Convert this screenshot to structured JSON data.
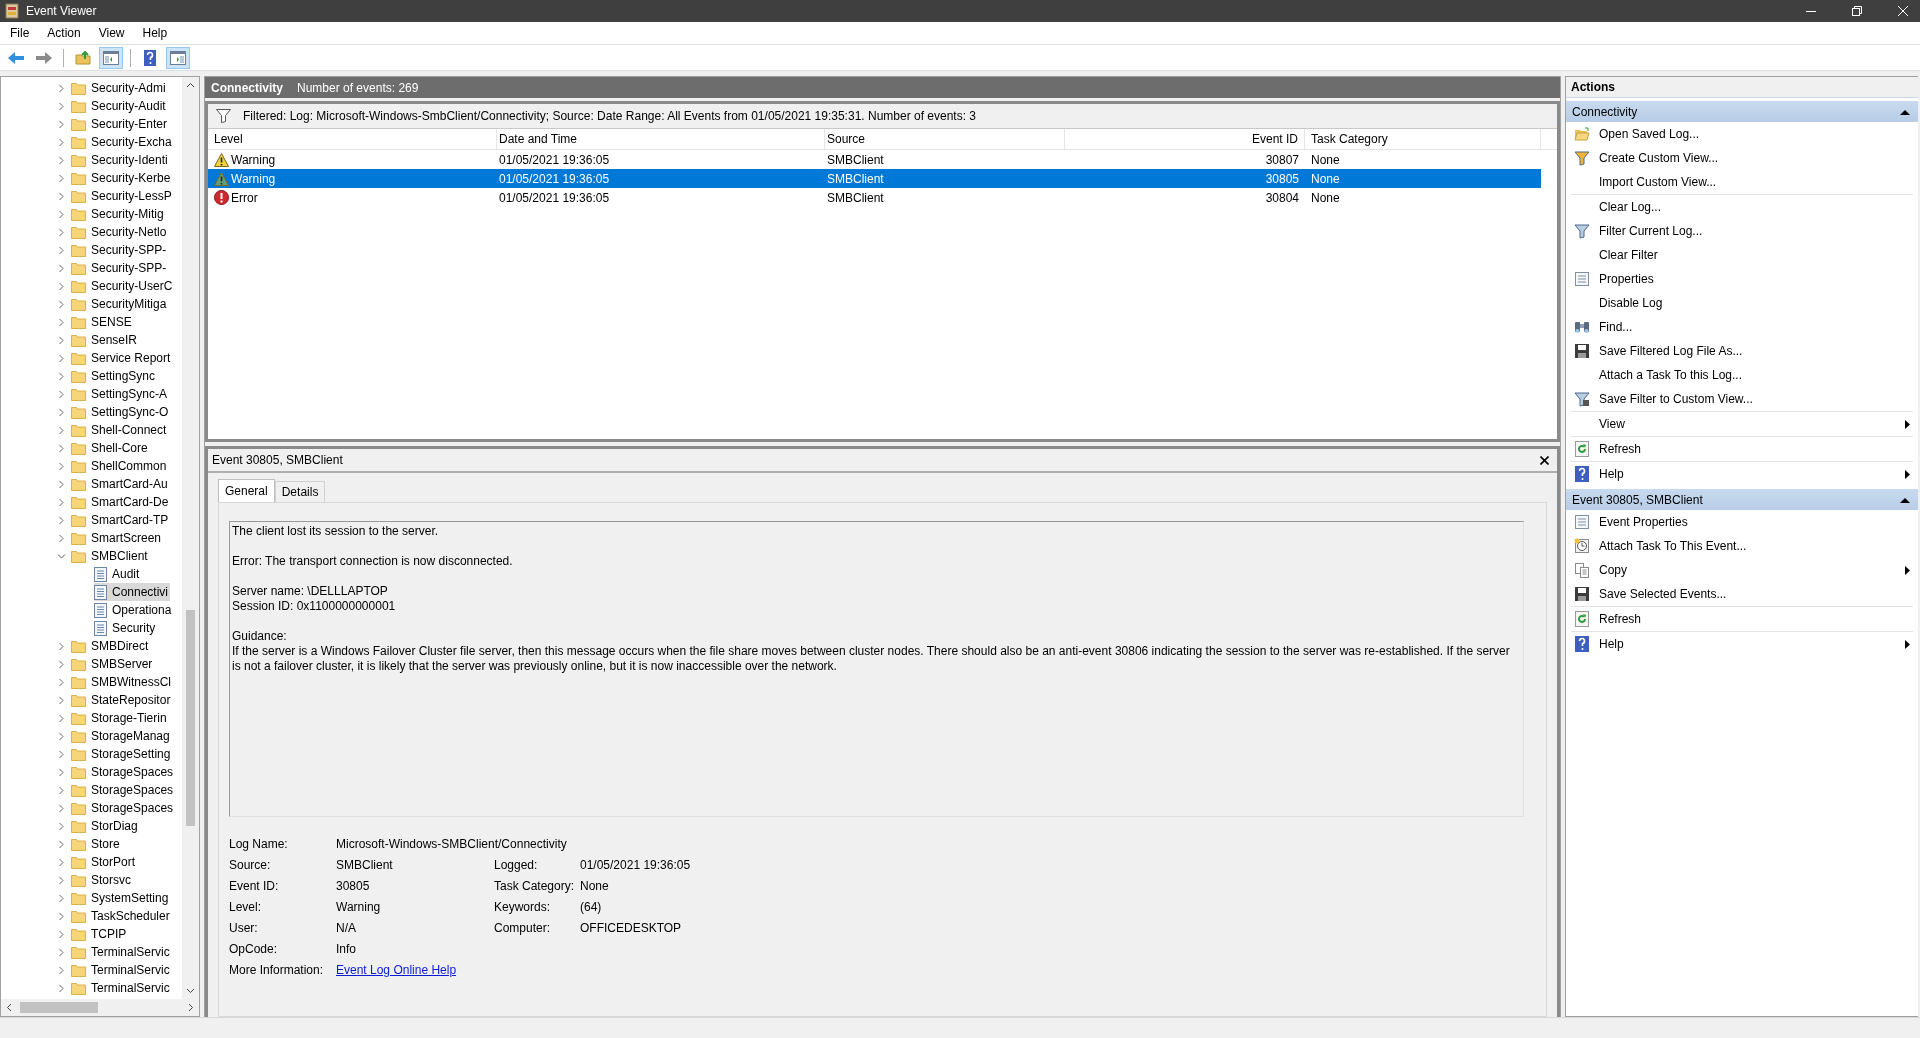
{
  "window": {
    "title": "Event Viewer"
  },
  "menu": [
    "File",
    "Action",
    "View",
    "Help"
  ],
  "toolbar": [
    {
      "kind": "back",
      "pressed": false
    },
    {
      "kind": "forward",
      "pressed": false
    },
    {
      "kind": "folder-up",
      "pressed": false
    },
    {
      "kind": "tree-pane",
      "pressed": true
    },
    {
      "kind": "help",
      "pressed": false
    },
    {
      "kind": "action-pane",
      "pressed": true
    }
  ],
  "tree": [
    {
      "label": "Security-Admi",
      "expanded": false,
      "selected": false
    },
    {
      "label": "Security-Audit",
      "expanded": false,
      "selected": false
    },
    {
      "label": "Security-Enter",
      "expanded": false,
      "selected": false
    },
    {
      "label": "Security-Excha",
      "expanded": false,
      "selected": false
    },
    {
      "label": "Security-Identi",
      "expanded": false,
      "selected": false
    },
    {
      "label": "Security-Kerbe",
      "expanded": false,
      "selected": false
    },
    {
      "label": "Security-LessP",
      "expanded": false,
      "selected": false
    },
    {
      "label": "Security-Mitig",
      "expanded": false,
      "selected": false
    },
    {
      "label": "Security-Netlo",
      "expanded": false,
      "selected": false
    },
    {
      "label": "Security-SPP-",
      "expanded": false,
      "selected": false
    },
    {
      "label": "Security-SPP-",
      "expanded": false,
      "selected": false
    },
    {
      "label": "Security-UserC",
      "expanded": false,
      "selected": false
    },
    {
      "label": "SecurityMitiga",
      "expanded": false,
      "selected": false
    },
    {
      "label": "SENSE",
      "expanded": false,
      "selected": false
    },
    {
      "label": "SenseIR",
      "expanded": false,
      "selected": false
    },
    {
      "label": "Service Report",
      "expanded": false,
      "selected": false
    },
    {
      "label": "SettingSync",
      "expanded": false,
      "selected": false
    },
    {
      "label": "SettingSync-A",
      "expanded": false,
      "selected": false
    },
    {
      "label": "SettingSync-O",
      "expanded": false,
      "selected": false
    },
    {
      "label": "Shell-Connect",
      "expanded": false,
      "selected": false
    },
    {
      "label": "Shell-Core",
      "expanded": false,
      "selected": false
    },
    {
      "label": "ShellCommon",
      "expanded": false,
      "selected": false
    },
    {
      "label": "SmartCard-Au",
      "expanded": false,
      "selected": false
    },
    {
      "label": "SmartCard-De",
      "expanded": false,
      "selected": false
    },
    {
      "label": "SmartCard-TP",
      "expanded": false,
      "selected": false
    },
    {
      "label": "SmartScreen",
      "expanded": false,
      "selected": false
    },
    {
      "label": "SMBClient",
      "expanded": true,
      "selected": false,
      "children": [
        {
          "label": "Audit",
          "selected": false
        },
        {
          "label": "Connectivi",
          "selected": true
        },
        {
          "label": "Operationa",
          "selected": false
        },
        {
          "label": "Security",
          "selected": false
        }
      ]
    },
    {
      "label": "SMBDirect",
      "expanded": false,
      "selected": false
    },
    {
      "label": "SMBServer",
      "expanded": false,
      "selected": false
    },
    {
      "label": "SMBWitnessCl",
      "expanded": false,
      "selected": false
    },
    {
      "label": "StateRepositor",
      "expanded": false,
      "selected": false
    },
    {
      "label": "Storage-Tierin",
      "expanded": false,
      "selected": false
    },
    {
      "label": "StorageManag",
      "expanded": false,
      "selected": false
    },
    {
      "label": "StorageSetting",
      "expanded": false,
      "selected": false
    },
    {
      "label": "StorageSpaces",
      "expanded": false,
      "selected": false
    },
    {
      "label": "StorageSpaces",
      "expanded": false,
      "selected": false
    },
    {
      "label": "StorageSpaces",
      "expanded": false,
      "selected": false
    },
    {
      "label": "StorDiag",
      "expanded": false,
      "selected": false
    },
    {
      "label": "Store",
      "expanded": false,
      "selected": false
    },
    {
      "label": "StorPort",
      "expanded": false,
      "selected": false
    },
    {
      "label": "Storsvc",
      "expanded": false,
      "selected": false
    },
    {
      "label": "SystemSetting",
      "expanded": false,
      "selected": false
    },
    {
      "label": "TaskScheduler",
      "expanded": false,
      "selected": false
    },
    {
      "label": "TCPIP",
      "expanded": false,
      "selected": false
    },
    {
      "label": "TerminalServic",
      "expanded": false,
      "selected": false
    },
    {
      "label": "TerminalServic",
      "expanded": false,
      "selected": false
    },
    {
      "label": "TerminalServic",
      "expanded": false,
      "selected": false
    }
  ],
  "log_header": {
    "name": "Connectivity",
    "count": "Number of events: 269"
  },
  "filter": "Filtered: Log: Microsoft-Windows-SmbClient/Connectivity; Source: Date Range: All Events from 01/05/2021 19:35:31. Number of events: 3",
  "table": {
    "columns": [
      "Level",
      "Date and Time",
      "Source",
      "Event ID",
      "Task Category"
    ],
    "rows": [
      {
        "kind": "warning",
        "level": "Warning",
        "date": "01/05/2021 19:36:05",
        "source": "SMBClient",
        "event_id": "30807",
        "task_category": "None",
        "selected": false
      },
      {
        "kind": "warning",
        "level": "Warning",
        "date": "01/05/2021 19:36:05",
        "source": "SMBClient",
        "event_id": "30805",
        "task_category": "None",
        "selected": true
      },
      {
        "kind": "error",
        "level": "Error",
        "date": "01/05/2021 19:36:05",
        "source": "SMBClient",
        "event_id": "30804",
        "task_category": "None",
        "selected": false
      }
    ]
  },
  "detail": {
    "title": "Event 30805, SMBClient",
    "tabs": [
      {
        "label": "General",
        "selected": true
      },
      {
        "label": "Details",
        "selected": false
      }
    ],
    "description": [
      [
        "The client lost its session to the server."
      ],
      [
        "Error: The transport connection is now disconnected."
      ],
      [
        "Server name: \\DELLLAPTOP",
        "Session ID: 0x1100000000001"
      ],
      [
        "Guidance:",
        "If the server is a Windows Failover Cluster file server, then this message occurs when the file share moves between cluster nodes. There should also be an anti-event 30806 indicating the session to the server was re-established. If the server is not a failover cluster, it is likely that the server was previously online, but it is now inaccessible over the network."
      ]
    ],
    "log_name": {
      "label": "Log Name:",
      "value": "Microsoft-Windows-SMBClient/Connectivity"
    },
    "fields": [
      [
        {
          "label": "Source:",
          "value": "SMBClient"
        },
        {
          "label": "Logged:",
          "value": "01/05/2021 19:36:05"
        }
      ],
      [
        {
          "label": "Event ID:",
          "value": "30805"
        },
        {
          "label": "Task Category:",
          "value": "None"
        }
      ],
      [
        {
          "label": "Level:",
          "value": "Warning"
        },
        {
          "label": "Keywords:",
          "value": "(64)"
        }
      ],
      [
        {
          "label": "User:",
          "value": "N/A"
        },
        {
          "label": "Computer:",
          "value": "OFFICEDESKTOP"
        }
      ],
      [
        {
          "label": "OpCode:",
          "value": "Info"
        }
      ]
    ],
    "more_information": {
      "label": "More Information:",
      "link": "Event Log Online Help"
    }
  },
  "actions": {
    "title": "Actions",
    "sections": [
      {
        "title": "Connectivity",
        "expanded": true,
        "groups": [
          [
            {
              "label": "Open Saved Log...",
              "kind": "open",
              "submenu": false
            },
            {
              "label": "Create Custom View...",
              "kind": "filter",
              "submenu": false
            },
            {
              "label": "Import Custom View...",
              "kind": "plain",
              "submenu": false
            }
          ],
          [
            {
              "label": "Clear Log...",
              "kind": "plain",
              "submenu": false
            },
            {
              "label": "Filter Current Log...",
              "kind": "filter-plain",
              "submenu": false
            },
            {
              "label": "Clear Filter",
              "kind": "plain",
              "submenu": false
            },
            {
              "label": "Properties",
              "kind": "properties",
              "submenu": false
            },
            {
              "label": "Disable Log",
              "kind": "plain",
              "submenu": false
            },
            {
              "label": "Find...",
              "kind": "find",
              "submenu": false
            },
            {
              "label": "Save Filtered Log File As...",
              "kind": "save",
              "submenu": false
            },
            {
              "label": "Attach a Task To this Log...",
              "kind": "plain",
              "submenu": false
            },
            {
              "label": "Save Filter to Custom View...",
              "kind": "save-filter",
              "submenu": false
            }
          ],
          [
            {
              "label": "View",
              "kind": "plain",
              "submenu": true
            }
          ],
          [
            {
              "label": "Refresh",
              "kind": "refresh",
              "submenu": false
            }
          ],
          [
            {
              "label": "Help",
              "kind": "help",
              "submenu": true
            }
          ]
        ]
      },
      {
        "title": "Event 30805, SMBClient",
        "expanded": true,
        "groups": [
          [
            {
              "label": "Event Properties",
              "kind": "properties",
              "submenu": false
            },
            {
              "label": "Attach Task To This Event...",
              "kind": "task",
              "submenu": false
            },
            {
              "label": "Copy",
              "kind": "copy",
              "submenu": true
            },
            {
              "label": "Save Selected Events...",
              "kind": "save",
              "submenu": false
            }
          ],
          [
            {
              "label": "Refresh",
              "kind": "refresh",
              "submenu": false
            }
          ],
          [
            {
              "label": "Help",
              "kind": "help",
              "submenu": true
            }
          ]
        ]
      }
    ]
  }
}
